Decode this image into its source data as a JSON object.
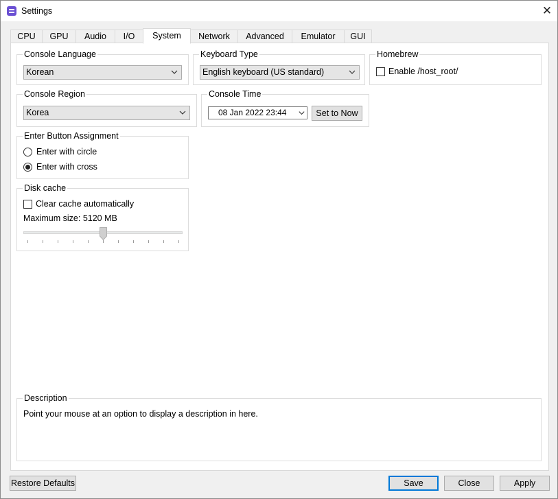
{
  "window": {
    "title": "Settings",
    "close_glyph": "✕"
  },
  "tabs": [
    {
      "label": "CPU"
    },
    {
      "label": "GPU"
    },
    {
      "label": "Audio"
    },
    {
      "label": "I/O"
    },
    {
      "label": "System"
    },
    {
      "label": "Network"
    },
    {
      "label": "Advanced"
    },
    {
      "label": "Emulator"
    },
    {
      "label": "GUI"
    }
  ],
  "active_tab": "System",
  "console_language": {
    "title": "Console Language",
    "value": "Korean"
  },
  "keyboard_type": {
    "title": "Keyboard Type",
    "value": "English keyboard (US standard)"
  },
  "homebrew": {
    "title": "Homebrew",
    "checkbox_label": "Enable /host_root/",
    "checked": false
  },
  "console_region": {
    "title": "Console Region",
    "value": "Korea"
  },
  "console_time": {
    "title": "Console Time",
    "value": "08 Jan 2022 23:44",
    "set_now_label": "Set to Now"
  },
  "enter_button": {
    "title": "Enter Button Assignment",
    "options": [
      {
        "label": "Enter with circle",
        "checked": false
      },
      {
        "label": "Enter with cross",
        "checked": true
      }
    ]
  },
  "disk_cache": {
    "title": "Disk cache",
    "checkbox_label": "Clear cache automatically",
    "checked": false,
    "max_size_label": "Maximum size: 5120 MB",
    "slider_fraction": 0.5,
    "tick_count": 11
  },
  "description": {
    "title": "Description",
    "text": "Point your mouse at an option to display a description in here."
  },
  "footer": {
    "restore_label": "Restore Defaults",
    "save_label": "Save",
    "close_label": "Close",
    "apply_label": "Apply"
  },
  "colors": {
    "accent": "#0078d7",
    "app_icon": "#6a4fd3"
  }
}
